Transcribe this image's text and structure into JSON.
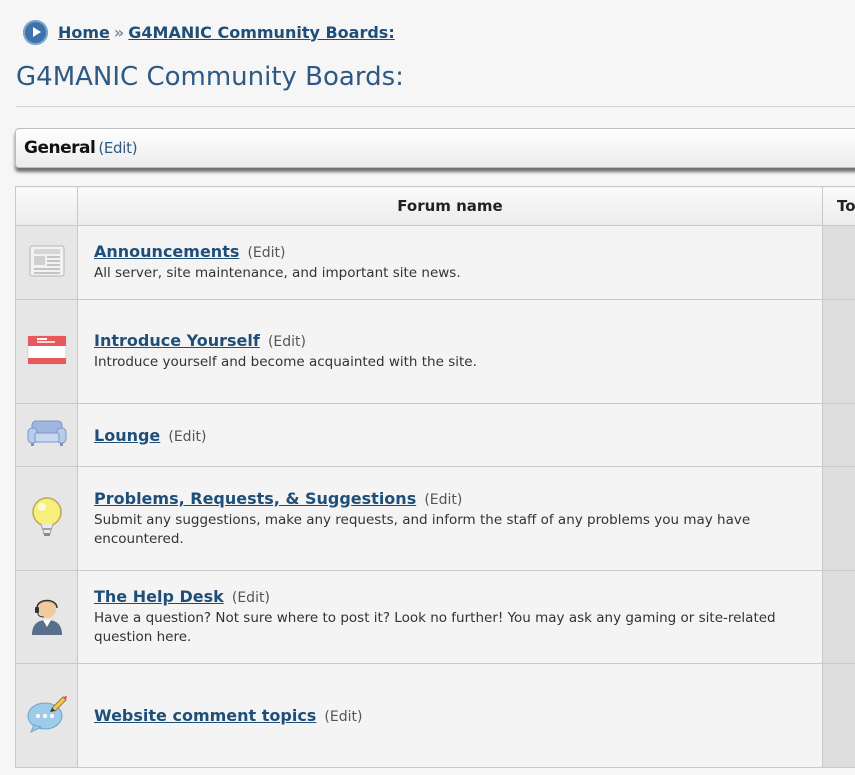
{
  "breadcrumb": {
    "home": "Home",
    "separator": "»",
    "current": "G4MANIC Community Boards:"
  },
  "page_title": "G4MANIC Community Boards:",
  "category": {
    "name": "General",
    "edit": "(Edit)"
  },
  "table": {
    "col_forum_name": "Forum name",
    "col_topics_partial": "To"
  },
  "forums": [
    {
      "name": "Announcements",
      "edit": "(Edit)",
      "description": "All server, site maintenance, and important site news.",
      "icon": "newspaper-icon"
    },
    {
      "name": "Introduce Yourself",
      "edit": "(Edit)",
      "description": "Introduce yourself and become acquainted with the site.",
      "icon": "name-tag-icon"
    },
    {
      "name": "Lounge",
      "edit": "(Edit)",
      "description": "",
      "icon": "couch-icon"
    },
    {
      "name": "Problems, Requests, & Suggestions",
      "edit": "(Edit)",
      "description": "Submit any suggestions, make any requests, and inform the staff of any problems you may have encountered.",
      "icon": "lightbulb-icon"
    },
    {
      "name": "The Help Desk",
      "edit": "(Edit)",
      "description": "Have a question? Not sure where to post it? Look no further! You may ask any gaming or site-related question here.",
      "icon": "help-agent-icon"
    },
    {
      "name": "Website comment topics",
      "edit": "(Edit)",
      "description": "",
      "icon": "comment-bubble-icon"
    }
  ]
}
